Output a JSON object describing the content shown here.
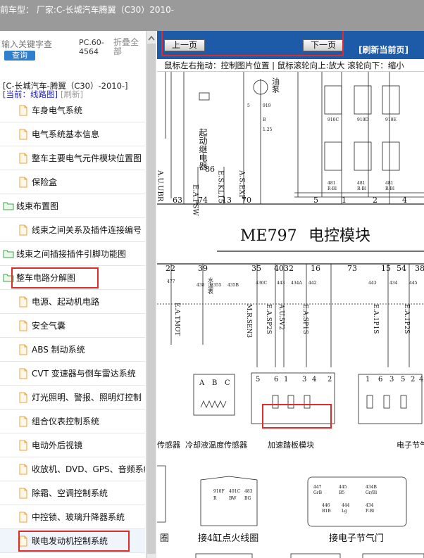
{
  "window": {
    "title": "前车型： 厂家:C-长城汽车腾翼（C30）2010-"
  },
  "search": {
    "placeholder": "输入关键字查",
    "button": "查询",
    "model_code": "PC.60-4564",
    "collapse_all": "折叠全部"
  },
  "vehicle_title": "[C-长城汽车-腾翼（C30）-2010-]",
  "current": {
    "label": "[当前：线路图]",
    "refresh": "[刷新]"
  },
  "tree": [
    {
      "label": "车身电气系统",
      "level": 2,
      "icon": "file-icon"
    },
    {
      "label": "电气系统基本信息",
      "level": 2,
      "icon": "file-icon"
    },
    {
      "label": "整车主要电气元件模块位置图",
      "level": 2,
      "icon": "file-icon"
    },
    {
      "label": "保险盒",
      "level": 2,
      "icon": "file-icon"
    },
    {
      "label": "线束布置图",
      "level": 1,
      "icon": "folder-icon"
    },
    {
      "label": "线束之间关系及插件连接编号",
      "level": 2,
      "icon": "file-icon"
    },
    {
      "label": "线束之间插接插件引脚功能图",
      "level": 1,
      "icon": "folder-icon"
    },
    {
      "label": "整车电路分解图",
      "level": 1,
      "icon": "folder-icon",
      "highlighted": true
    },
    {
      "label": "电源、起动机电路",
      "level": 2,
      "icon": "file-icon"
    },
    {
      "label": "安全气囊",
      "level": 2,
      "icon": "file-icon"
    },
    {
      "label": "ABS 制动系统",
      "level": 2,
      "icon": "file-icon"
    },
    {
      "label": "CVT 变速器与倒车雷达系统",
      "level": 2,
      "icon": "file-icon"
    },
    {
      "label": "灯光照明、警报、照明灯控制",
      "level": 2,
      "icon": "file-icon"
    },
    {
      "label": "组合仪表控制系统",
      "level": 2,
      "icon": "file-icon"
    },
    {
      "label": "电动外后视镜",
      "level": 2,
      "icon": "file-icon"
    },
    {
      "label": "收放机、DVD、GPS、音频系统",
      "level": 2,
      "icon": "file-icon"
    },
    {
      "label": "除霜、空调控制系统",
      "level": 2,
      "icon": "file-icon"
    },
    {
      "label": "中控锁、玻璃升降器系统",
      "level": 2,
      "icon": "file-icon"
    },
    {
      "label": "联电发动机控制系统",
      "level": 2,
      "icon": "file-icon",
      "highlighted": true,
      "selected": true
    }
  ],
  "nav": {
    "prev": "上一页",
    "next": "下一页",
    "refresh": "[刷新当前页]"
  },
  "hint": "鼠标左右拖动：控制图片位置 | 鼠标滚轮向上:放大  滚轮向下：缩小",
  "diagram": {
    "module_name": "ME797",
    "module_label": "电控模块",
    "starter_relay": "起动继电器",
    "starter_relay_num": "86",
    "oil_pump": "油泵",
    "top_pins": [
      "63",
      "74",
      "13",
      "70",
      "5",
      "1",
      "2",
      "4"
    ],
    "top_signals": [
      "A.U.UBR",
      "E.A.PSW",
      "E.S.KL15",
      "A.S.EXP"
    ],
    "mid_pins": [
      "22",
      "39",
      "35",
      "40",
      "32",
      "16",
      "73",
      "15",
      "54",
      "38"
    ],
    "mid_signals": [
      "E.A.TMOT",
      "M.R.SEN3",
      "E.A.SP2S",
      "A.U.5V2",
      "E.A.SP1S",
      "E.A.1P1S",
      "E.A.1P2S"
    ],
    "water_gauge": "水温表",
    "connector_pins": [
      "A",
      "B",
      "C",
      "5",
      "6",
      "1",
      "3",
      "4",
      "2",
      "1",
      "6",
      "3",
      "5",
      "2",
      "4"
    ],
    "sensor1": "传感器",
    "sensor2": "冷却液温度传感器",
    "accel_module": "加速踏板模块",
    "throttle": "电子节气",
    "ignition": "接4缸点火线圈",
    "throttle2": "接电子节气门",
    "coil_left": "圈",
    "box_texts": [
      "910F",
      "401C",
      "483",
      "447",
      "445",
      "434B",
      "446",
      "444",
      "434",
      "R",
      "BW",
      "BG",
      "GrB",
      "B5",
      "Gr/Bl",
      "B1B",
      "Lg",
      "P-Bl"
    ]
  }
}
